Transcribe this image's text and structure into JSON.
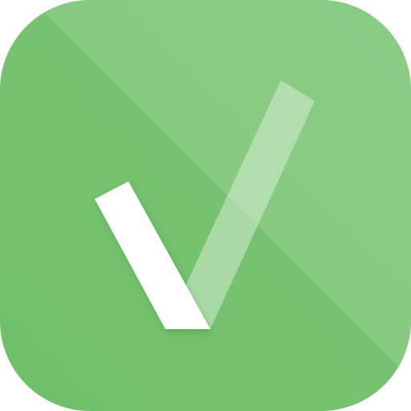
{
  "icon": {
    "name": "checkmark-app-icon",
    "colors": {
      "base_green": "#7CC576",
      "base_green_dark": "#6FBF69",
      "diagonal_light": "#96D28F",
      "check_stroke_solid": "#FFFFFF",
      "check_stroke_translucent": "#D6EDD2"
    }
  }
}
